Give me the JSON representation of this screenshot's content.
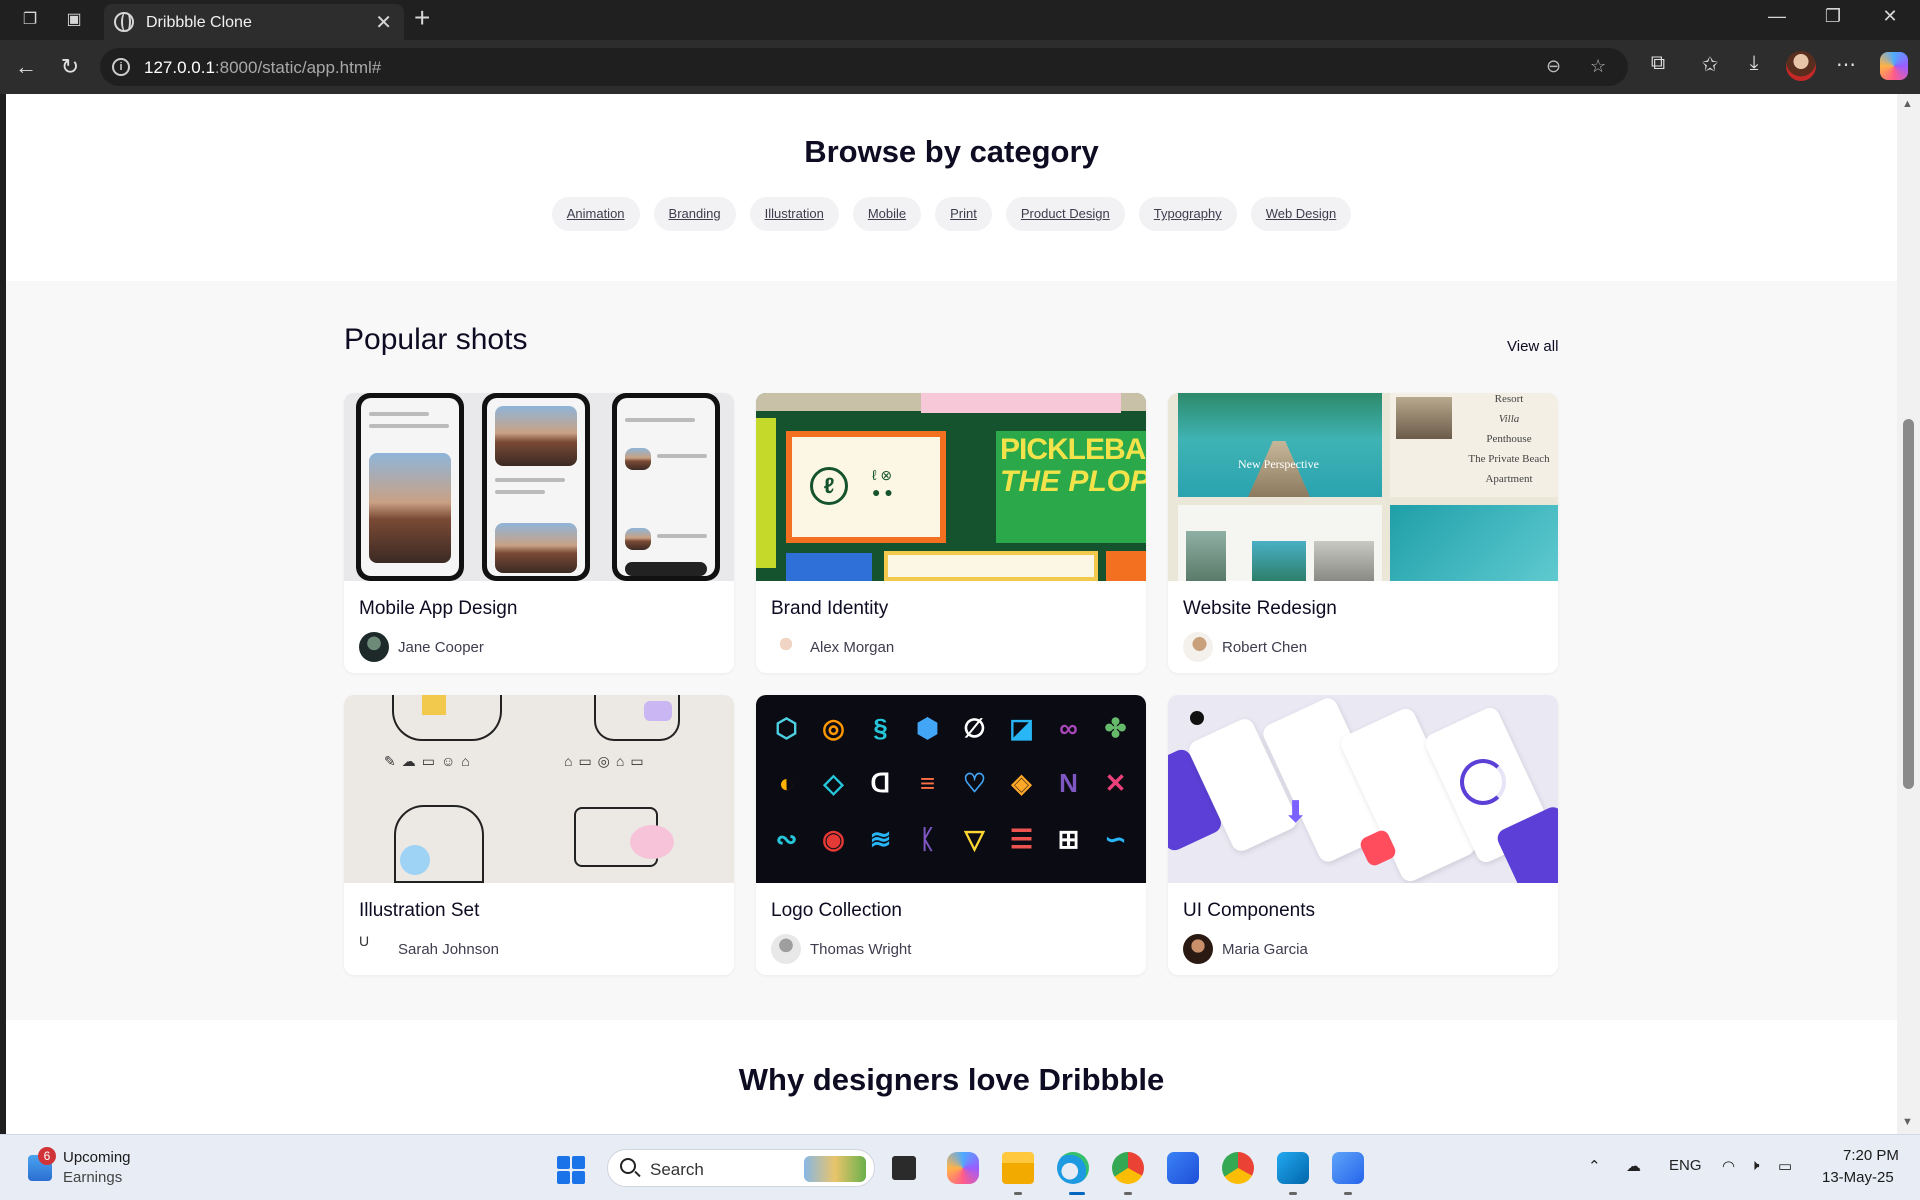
{
  "browser": {
    "tab_title": "Dribbble Clone",
    "url_host": "127.0.0.1",
    "url_rest": ":8000/static/app.html#"
  },
  "categories": {
    "title": "Browse by category",
    "items": [
      "Animation",
      "Branding",
      "Illustration",
      "Mobile",
      "Print",
      "Product Design",
      "Typography",
      "Web Design"
    ]
  },
  "popular": {
    "title": "Popular shots",
    "view_all": "View all",
    "shots": [
      {
        "title": "Mobile App Design",
        "author": "Jane Cooper"
      },
      {
        "title": "Brand Identity",
        "author": "Alex Morgan"
      },
      {
        "title": "Website Redesign",
        "author": "Robert Chen"
      },
      {
        "title": "Illustration Set",
        "author": "Sarah Johnson",
        "avatar_alt": "U"
      },
      {
        "title": "Logo Collection",
        "author": "Thomas Wright"
      },
      {
        "title": "UI Components",
        "author": "Maria Garcia"
      }
    ],
    "thumb_text": {
      "pickleball_line1": "PICKLEBALL",
      "pickleball_line2": "THE PLOP",
      "resort_lines": [
        "Resort",
        "Villa",
        "Penthouse",
        "The Private Beach",
        "Apartment"
      ],
      "new_perspective": "New Perspective"
    }
  },
  "why": {
    "title": "Why designers love Dribbble"
  },
  "taskbar": {
    "widget_badge": "6",
    "widget_line1": "Upcoming",
    "widget_line2": "Earnings",
    "search_placeholder": "Search",
    "language": "ENG",
    "time": "7:20 PM",
    "date": "13-May-25"
  },
  "colors": {
    "accent": "#ea4c89",
    "chip_bg": "#f2f2f4",
    "shots_bg": "#f8f8f9"
  }
}
